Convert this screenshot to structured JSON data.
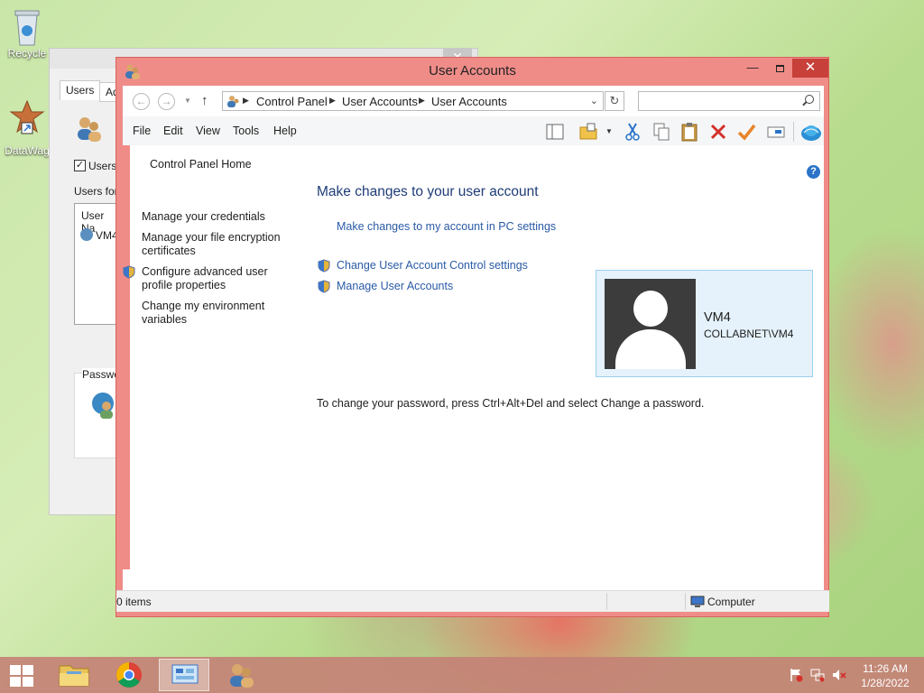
{
  "desktop": {
    "icons": [
      {
        "label": "Recycle",
        "icon": "recycle-bin-icon"
      },
      {
        "label": "DataWag",
        "icon": "datawag-shortcut-icon"
      }
    ]
  },
  "background_dialog": {
    "tabs": [
      "Users",
      "Ad"
    ],
    "checkbox_label": "Users",
    "users_for_label": "Users for",
    "column_header": "User Na",
    "user_row": "VM4",
    "password_group": "Passwo"
  },
  "window": {
    "title": "User Accounts",
    "controls": {
      "minimize": "—",
      "close": "✕"
    },
    "address": {
      "crumbs": [
        "Control Panel",
        "User Accounts",
        "User Accounts"
      ]
    },
    "search": {
      "placeholder": ""
    },
    "menu": [
      "File",
      "Edit",
      "View",
      "Tools",
      "Help"
    ],
    "left_pane": {
      "home": "Control Panel Home",
      "links": [
        "Manage your credentials",
        "Manage your file encryption certificates",
        "Configure advanced user profile properties",
        "Change my environment variables"
      ]
    },
    "main": {
      "heading": "Make changes to your user account",
      "pc_settings_link": "Make changes to my account in PC settings",
      "uac_link": "Change User Account Control settings",
      "manage_link": "Manage User Accounts",
      "password_info": "To change your password, press Ctrl+Alt+Del and select Change a password."
    },
    "account": {
      "name": "VM4",
      "domain": "COLLABNET\\VM4"
    },
    "status": {
      "items": "0 items",
      "location": "Computer"
    }
  },
  "taskbar": {
    "clock_time": "11:26 AM",
    "clock_date": "1/28/2022"
  },
  "colors": {
    "window_frame": "#ef8c88",
    "close_button": "#c7403a",
    "link": "#2a5aa6",
    "heading": "#1e3c78",
    "card_bg": "#e5f2fb"
  }
}
